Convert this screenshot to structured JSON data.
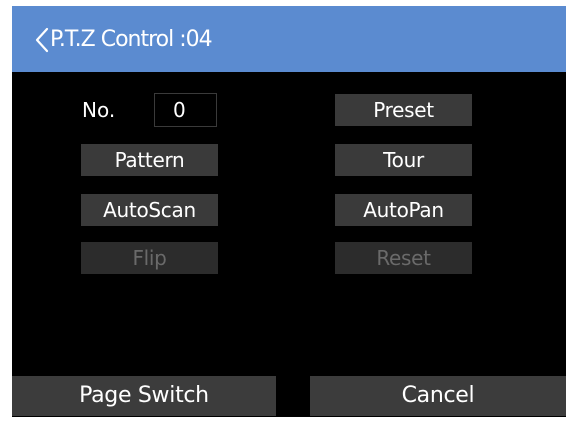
{
  "titlebar": {
    "back_icon": "chevron-left-icon",
    "title": "P.T.Z Control :04"
  },
  "number_field": {
    "label": "No.",
    "value": "0"
  },
  "buttons": {
    "preset": "Preset",
    "pattern": "Pattern",
    "tour": "Tour",
    "autoscan": "AutoScan",
    "autopan": "AutoPan",
    "flip": "Flip",
    "reset": "Reset"
  },
  "states": {
    "flip_enabled": false,
    "reset_enabled": false
  },
  "footer": {
    "page_switch": "Page Switch",
    "cancel": "Cancel"
  },
  "colors": {
    "titlebar": "#5b8bd0",
    "background": "#000000",
    "button": "#3a3a3a",
    "text": "#ffffff",
    "disabled_text": "#6a6a6a"
  }
}
